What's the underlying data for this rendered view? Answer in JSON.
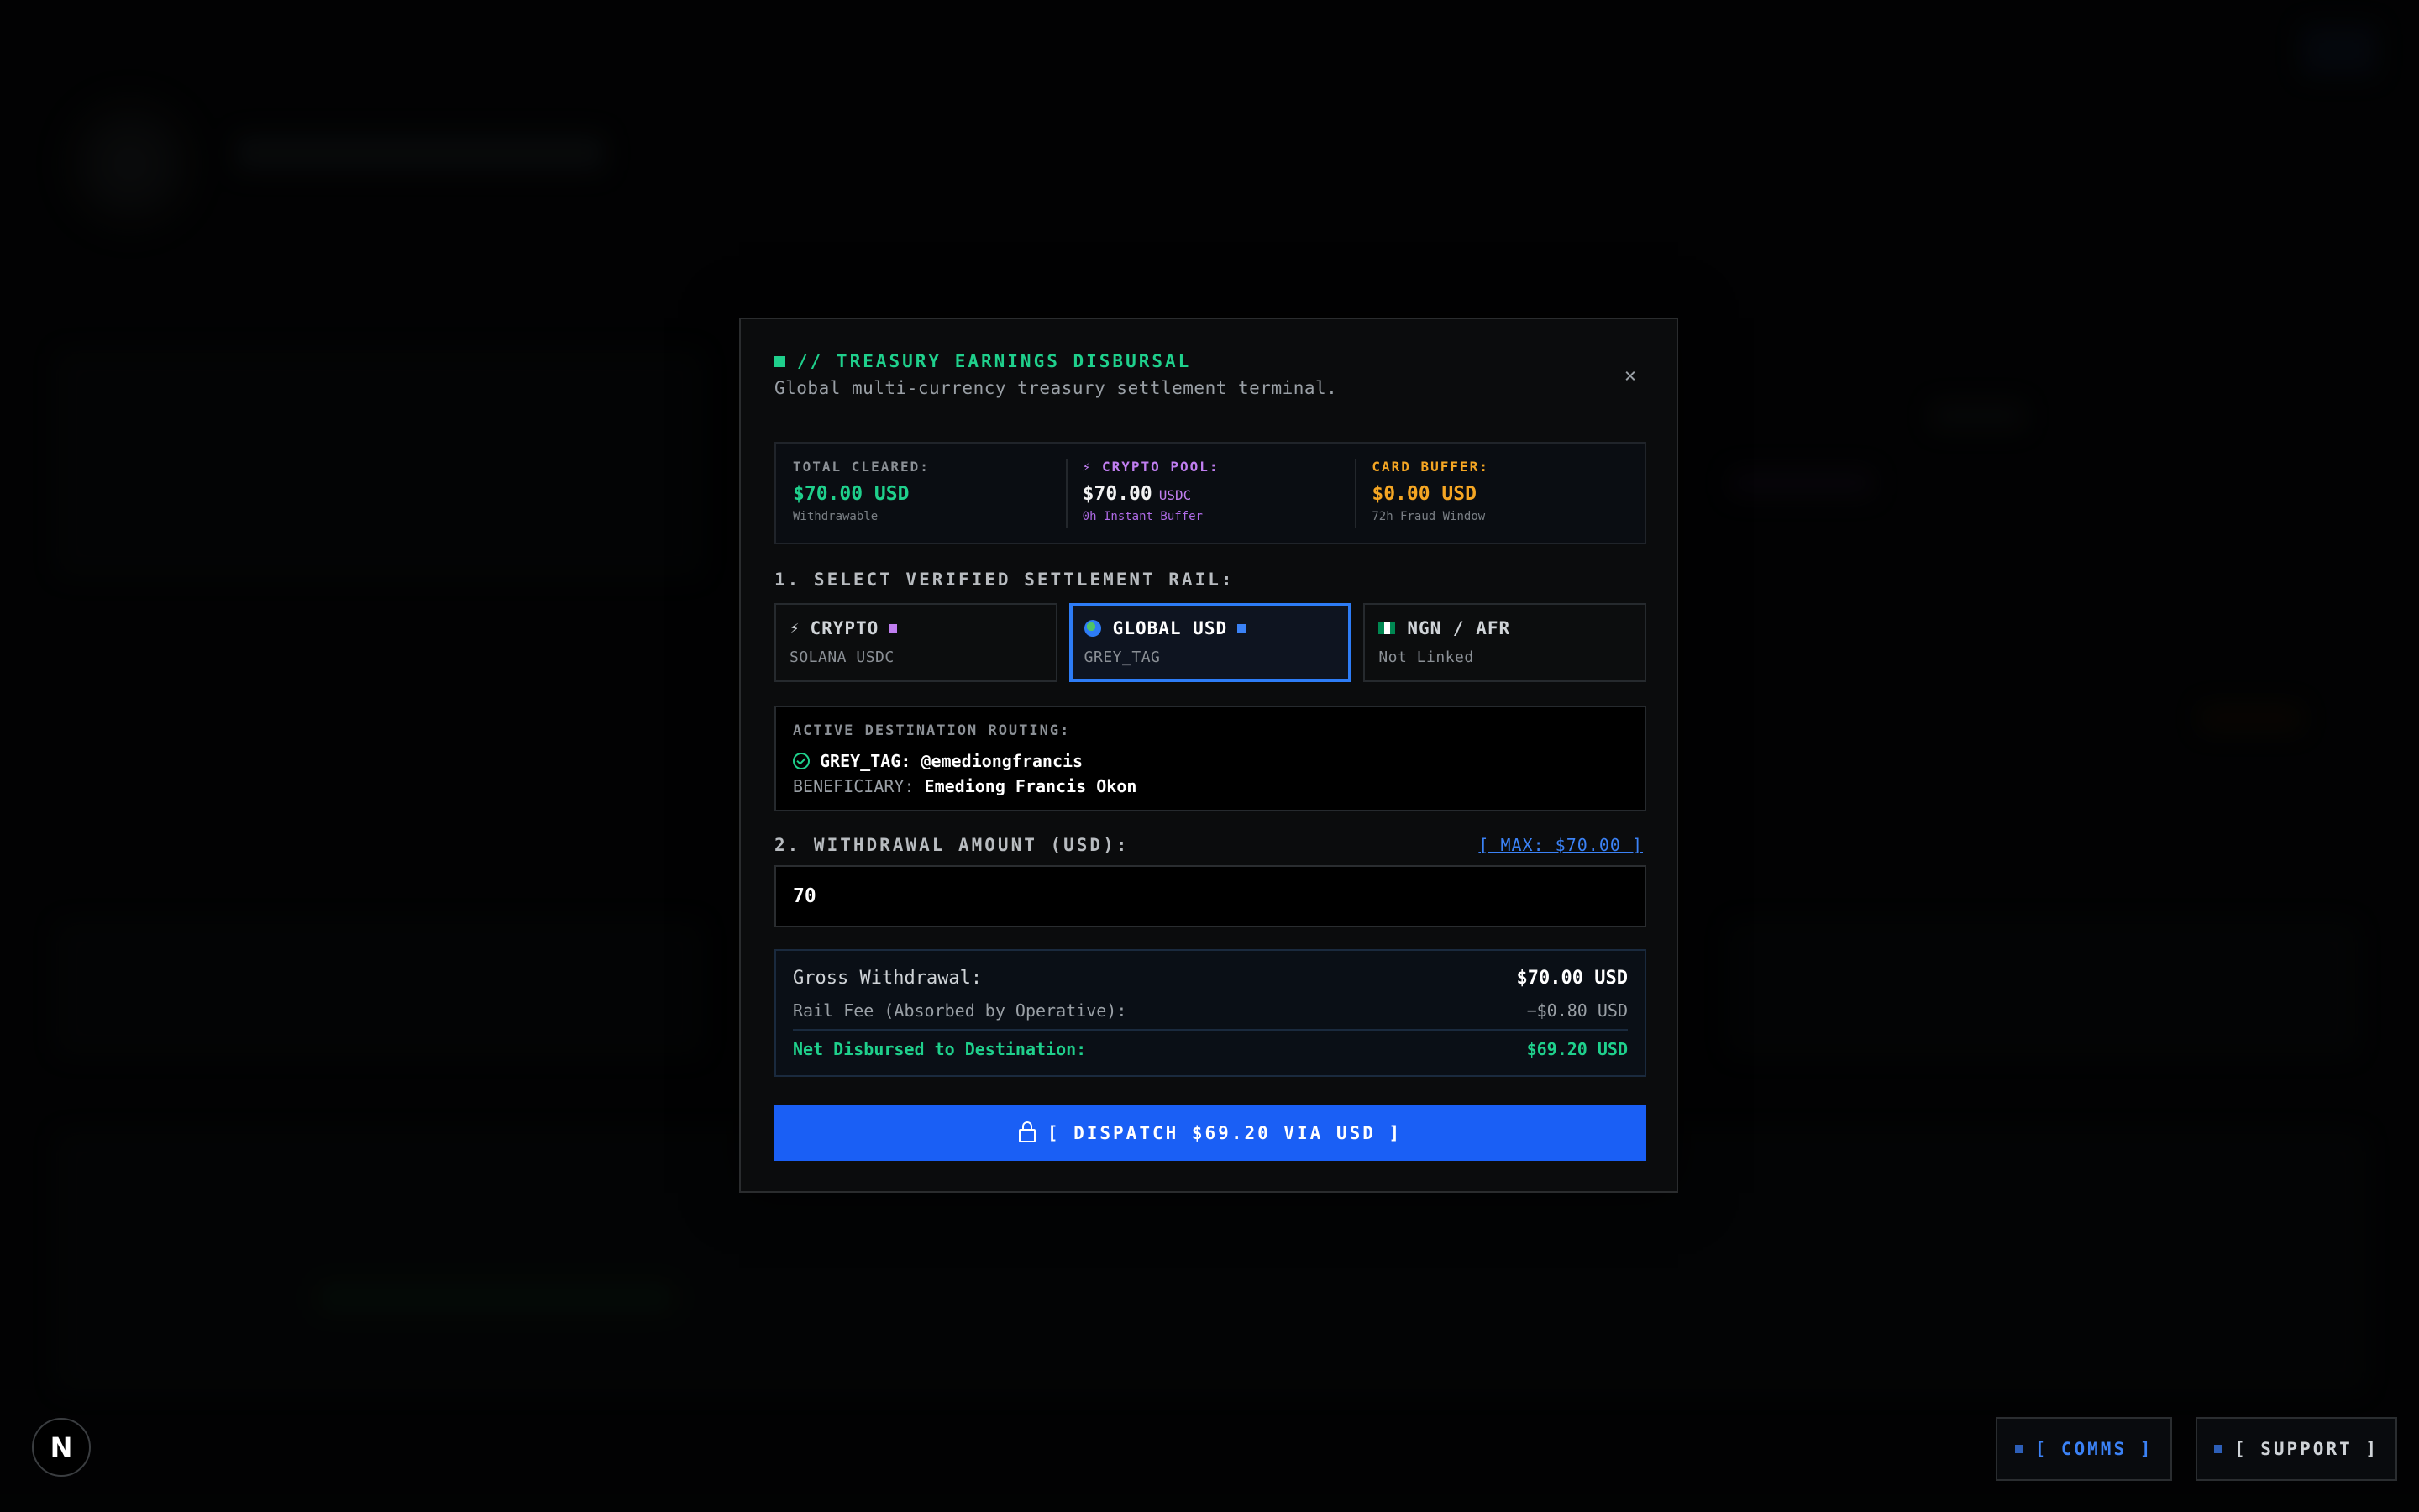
{
  "modal": {
    "title": "// TREASURY EARNINGS DISBURSAL",
    "subtitle": "Global multi-currency treasury settlement terminal.",
    "close_icon": "×",
    "accent": "#1fd08c"
  },
  "stats": [
    {
      "label": "TOTAL CLEARED:",
      "value": "$70.00 USD",
      "unit": "",
      "note": "Withdrawable",
      "color": "#1fd08c",
      "label_color": "#8b9096",
      "note_color": "#7b8086"
    },
    {
      "label": "⚡ CRYPTO POOL:",
      "value": "$70.00",
      "unit": "USDC",
      "note": "0h Instant Buffer",
      "color": "#f2f2f2",
      "label_color": "#c07ef0",
      "note_color": "#b06be8"
    },
    {
      "label": "CARD BUFFER:",
      "value": "$0.00 USD",
      "unit": "",
      "note": "72h Fraud Window",
      "color": "#f5a623",
      "label_color": "#f5a623",
      "note_color": "#7b8086"
    }
  ],
  "rail_section": {
    "label": "1. SELECT VERIFIED SETTLEMENT RAIL:"
  },
  "rails": [
    {
      "name": "CRYPTO",
      "sub": "SOLANA USDC",
      "icon": "lightning-icon",
      "glyph": "⚡",
      "dot": "#c07ef0",
      "active": false
    },
    {
      "name": "GLOBAL USD",
      "sub": "GREY_TAG",
      "icon": "globe-icon",
      "dot": "#3b82f6",
      "active": true
    },
    {
      "name": "NGN / AFR",
      "sub": "Not Linked",
      "icon": "nigeria-flag-icon",
      "active": false
    }
  ],
  "routing": {
    "label": "ACTIVE DESTINATION ROUTING:",
    "tag": "GREY_TAG: @emediongfrancis",
    "beneficiary_label": "BENEFICIARY:",
    "beneficiary": "Emediong Francis Okon"
  },
  "amount_section": {
    "label": "2. WITHDRAWAL AMOUNT (USD):",
    "max_link": "[ MAX: $70.00 ]",
    "value": "70"
  },
  "summary": {
    "gross_label": "Gross Withdrawal:",
    "gross_value": "$70.00 USD",
    "fee_label": "Rail Fee (Absorbed by Operative):",
    "fee_value": "−$0.80 USD",
    "net_label": "Net Disbursed to Destination:",
    "net_value": "$69.20 USD"
  },
  "dispatch": {
    "label": "[ DISPATCH $69.20 VIA USD ]",
    "color": "#1a5ff5"
  },
  "footer": {
    "badge": "N",
    "comms": "[ COMMS ]",
    "support": "[ SUPPORT ]"
  }
}
